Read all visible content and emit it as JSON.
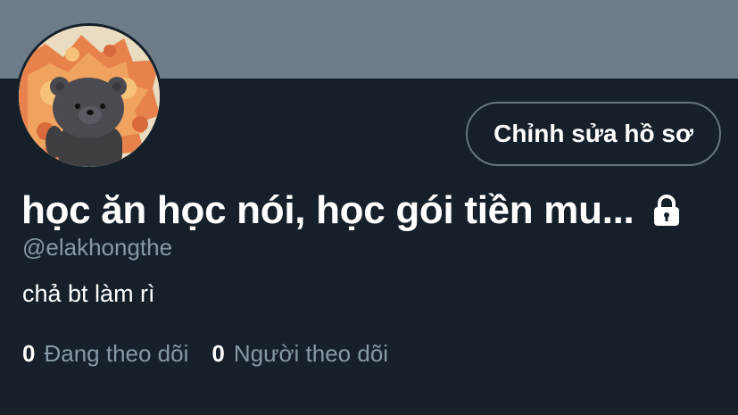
{
  "profile": {
    "display_name": "học ăn học nói, học gói tiền mu...",
    "handle": "@elakhongthe",
    "bio": "chả bt làm rì",
    "edit_button_label": "Chỉnh sửa hồ sơ",
    "locked_icon": "lock-icon",
    "avatar_description_icon": "bear-avatar"
  },
  "stats": [
    {
      "count": "0",
      "label": "Đang theo dõi"
    },
    {
      "count": "0",
      "label": "Người theo dõi"
    }
  ],
  "colors": {
    "banner": "#6e7b89",
    "background": "#15202b",
    "primary_text": "#ffffff",
    "secondary_text": "#8899a6",
    "button_border": "#66757f"
  }
}
